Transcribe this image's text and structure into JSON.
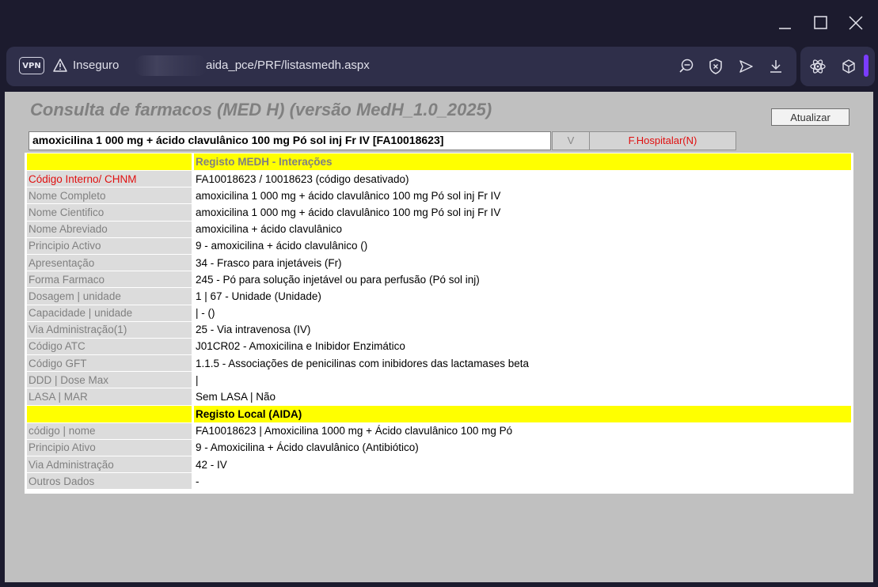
{
  "browser": {
    "vpn_label": "VPN",
    "insecure_label": "Inseguro",
    "url_text": "aida_pce/PRF/listasmedh.aspx",
    "window_controls": [
      "minimize",
      "maximize",
      "close"
    ],
    "toolbar_icons": [
      "zoom-out-icon",
      "shield-icon",
      "send-icon",
      "download-icon",
      "atom-icon",
      "cube-icon"
    ]
  },
  "page": {
    "title": "Consulta de farmacos (MED H) (versão MedH_1.0_2025)",
    "refresh_label": "Atualizar",
    "search_value": "amoxicilina 1 000 mg + ácido clavulânico 100 mg Pó sol inj Fr IV [FA10018623]",
    "v_button": "V",
    "hospital_button": "F.Hospitalar(N)"
  },
  "medh": {
    "header": "Registo MEDH - Interações",
    "rows": [
      {
        "label": "Código Interno/ CHNM",
        "value": "FA10018623 / 10018623 (código desativado)"
      },
      {
        "label": "Nome Completo",
        "value": "amoxicilina 1 000 mg + ácido clavulânico 100 mg Pó sol inj Fr IV"
      },
      {
        "label": "Nome Cientifico",
        "value": "amoxicilina 1 000 mg + ácido clavulânico 100 mg Pó sol inj Fr IV"
      },
      {
        "label": "Nome Abreviado",
        "value": "amoxicilina + ácido clavulânico"
      },
      {
        "label": "Principio Activo",
        "value": "9 - amoxicilina + ácido clavulânico ()"
      },
      {
        "label": "Apresentação",
        "value": "34 - Frasco para injetáveis (Fr)"
      },
      {
        "label": "Forma Farmaco",
        "value": "245 - Pó para solução injetável ou para perfusão (Pó sol inj)"
      },
      {
        "label": "Dosagem | unidade",
        "value": "1 | 67 - Unidade (Unidade)"
      },
      {
        "label": "Capacidade | unidade",
        "value": "| - ()"
      },
      {
        "label": "Via Administração(1)",
        "value": "25 - Via intravenosa (IV)"
      },
      {
        "label": "Código ATC",
        "value": "J01CR02 - Amoxicilina e Inibidor Enzimático"
      },
      {
        "label": "Código GFT",
        "value": "1.1.5 - Associações de penicilinas com inibidores das lactamases beta"
      },
      {
        "label": "DDD | Dose Max",
        "value": "|"
      },
      {
        "label": "LASA | MAR",
        "value": "Sem LASA | Não"
      }
    ]
  },
  "local": {
    "header": "Registo Local (AIDA)",
    "rows": [
      {
        "label": "código | nome",
        "value": "FA10018623 | Amoxicilina 1000 mg + Ácido clavulânico 100 mg Pó"
      },
      {
        "label": "Principio Ativo",
        "value": "9 - Amoxicilina + Ácido clavulânico (Antibiótico)"
      },
      {
        "label": "Via Administração",
        "value": "42 - IV"
      },
      {
        "label": "Outros Dados",
        "value": "-"
      }
    ]
  },
  "colors": {
    "header_yellow": "#ffff00",
    "label_grey": "#808080",
    "highlight_red": "#e01010",
    "accent_purple": "#7a3cff"
  }
}
